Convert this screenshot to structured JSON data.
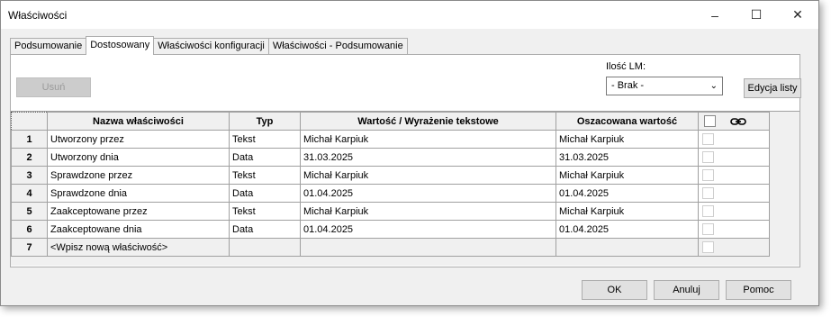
{
  "window": {
    "title": "Właściwości",
    "controls": {
      "minimize": "–",
      "maximize": "☐",
      "close": "✕"
    }
  },
  "tabs": [
    "Podsumowanie",
    "Dostosowany",
    "Właściwości konfiguracji",
    "Właściwości - Podsumowanie"
  ],
  "active_tab": "Dostosowany",
  "toolbar": {
    "delete_label": "Usuń",
    "lm_label": "Ilość LM:",
    "lm_value": "- Brak -",
    "edit_list_label": "Edycja listy"
  },
  "table": {
    "columns": [
      "",
      "Nazwa właściwości",
      "Typ",
      "Wartość / Wyrażenie tekstowe",
      "Oszacowana wartość",
      ""
    ],
    "rows": [
      {
        "num": "1",
        "name": "Utworzony przez",
        "type": "Tekst",
        "value": "Michał Karpiuk",
        "evaluated": "Michał Karpiuk"
      },
      {
        "num": "2",
        "name": "Utworzony dnia",
        "type": "Data",
        "value": "31.03.2025",
        "evaluated": "31.03.2025"
      },
      {
        "num": "3",
        "name": "Sprawdzone przez",
        "type": "Tekst",
        "value": "Michał Karpiuk",
        "evaluated": "Michał Karpiuk"
      },
      {
        "num": "4",
        "name": "Sprawdzone dnia",
        "type": "Data",
        "value": "01.04.2025",
        "evaluated": "01.04.2025"
      },
      {
        "num": "5",
        "name": "Zaakceptowane przez",
        "type": "Tekst",
        "value": "Michał Karpiuk",
        "evaluated": "Michał Karpiuk"
      },
      {
        "num": "6",
        "name": "Zaakceptowane dnia",
        "type": "Data",
        "value": "01.04.2025",
        "evaluated": "01.04.2025"
      }
    ],
    "new_row": {
      "num": "7",
      "name": "<Wpisz nową właściwość>"
    }
  },
  "footer": {
    "ok_label": "OK",
    "cancel_label": "Anuluj",
    "help_label": "Pomoc"
  }
}
